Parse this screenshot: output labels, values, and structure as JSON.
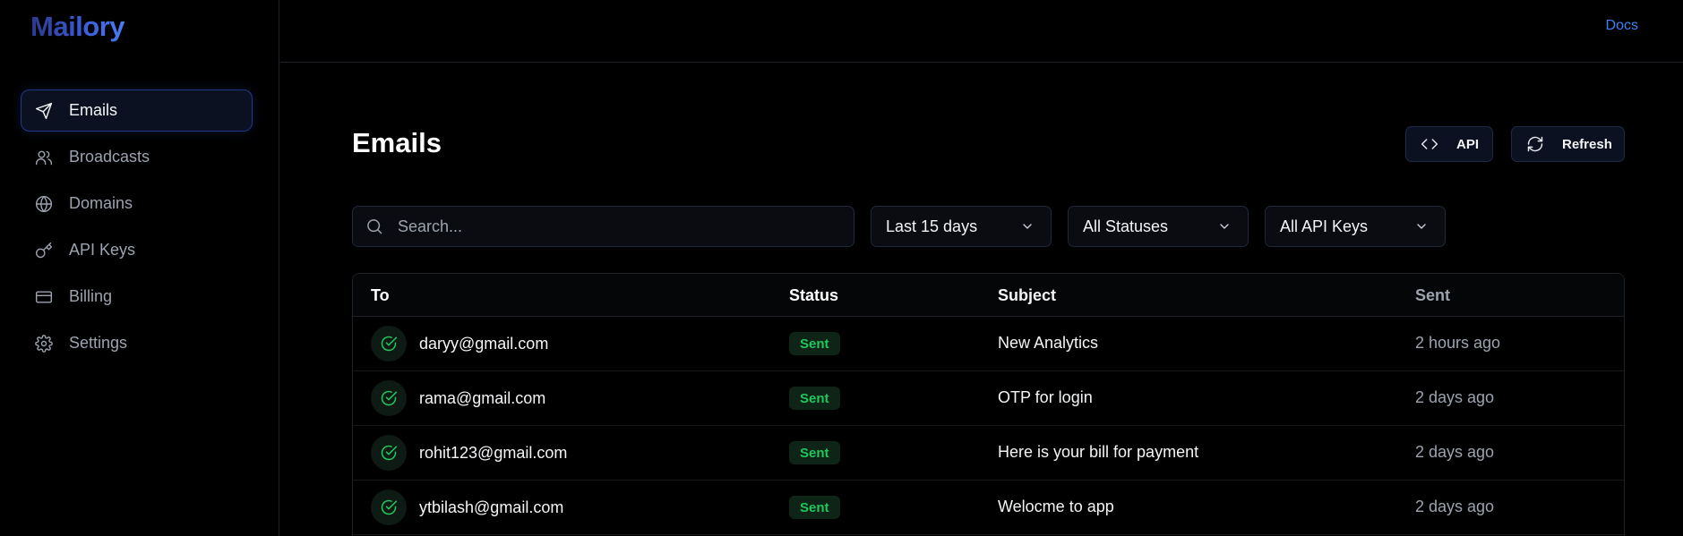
{
  "app": {
    "logo": "Mailory"
  },
  "topbar": {
    "docs_label": "Docs"
  },
  "sidebar": {
    "items": [
      {
        "label": "Emails",
        "icon": "send-icon",
        "active": true
      },
      {
        "label": "Broadcasts",
        "icon": "users-icon",
        "active": false
      },
      {
        "label": "Domains",
        "icon": "globe-icon",
        "active": false
      },
      {
        "label": "API Keys",
        "icon": "key-icon",
        "active": false
      },
      {
        "label": "Billing",
        "icon": "credit-card-icon",
        "active": false
      },
      {
        "label": "Settings",
        "icon": "gear-icon",
        "active": false
      }
    ]
  },
  "header": {
    "title": "Emails",
    "api_button": "API",
    "refresh_button": "Refresh"
  },
  "filters": {
    "search_placeholder": "Search...",
    "date_range": "Last 15 days",
    "status": "All Statuses",
    "api_keys": "All API Keys"
  },
  "table": {
    "columns": [
      "To",
      "Status",
      "Subject",
      "Sent"
    ],
    "rows": [
      {
        "to": "daryy@gmail.com",
        "status": "Sent",
        "subject": "New Analytics",
        "sent": "2 hours ago"
      },
      {
        "to": "rama@gmail.com",
        "status": "Sent",
        "subject": "OTP for login",
        "sent": "2 days ago"
      },
      {
        "to": "rohit123@gmail.com",
        "status": "Sent",
        "subject": "Here is your bill for payment",
        "sent": "2 days ago"
      },
      {
        "to": "ytbilash@gmail.com",
        "status": "Sent",
        "subject": "Welocme to app",
        "sent": "2 days ago"
      }
    ]
  },
  "colors": {
    "accent": "#3b82f6",
    "success": "#22c55e",
    "background": "#000000"
  }
}
